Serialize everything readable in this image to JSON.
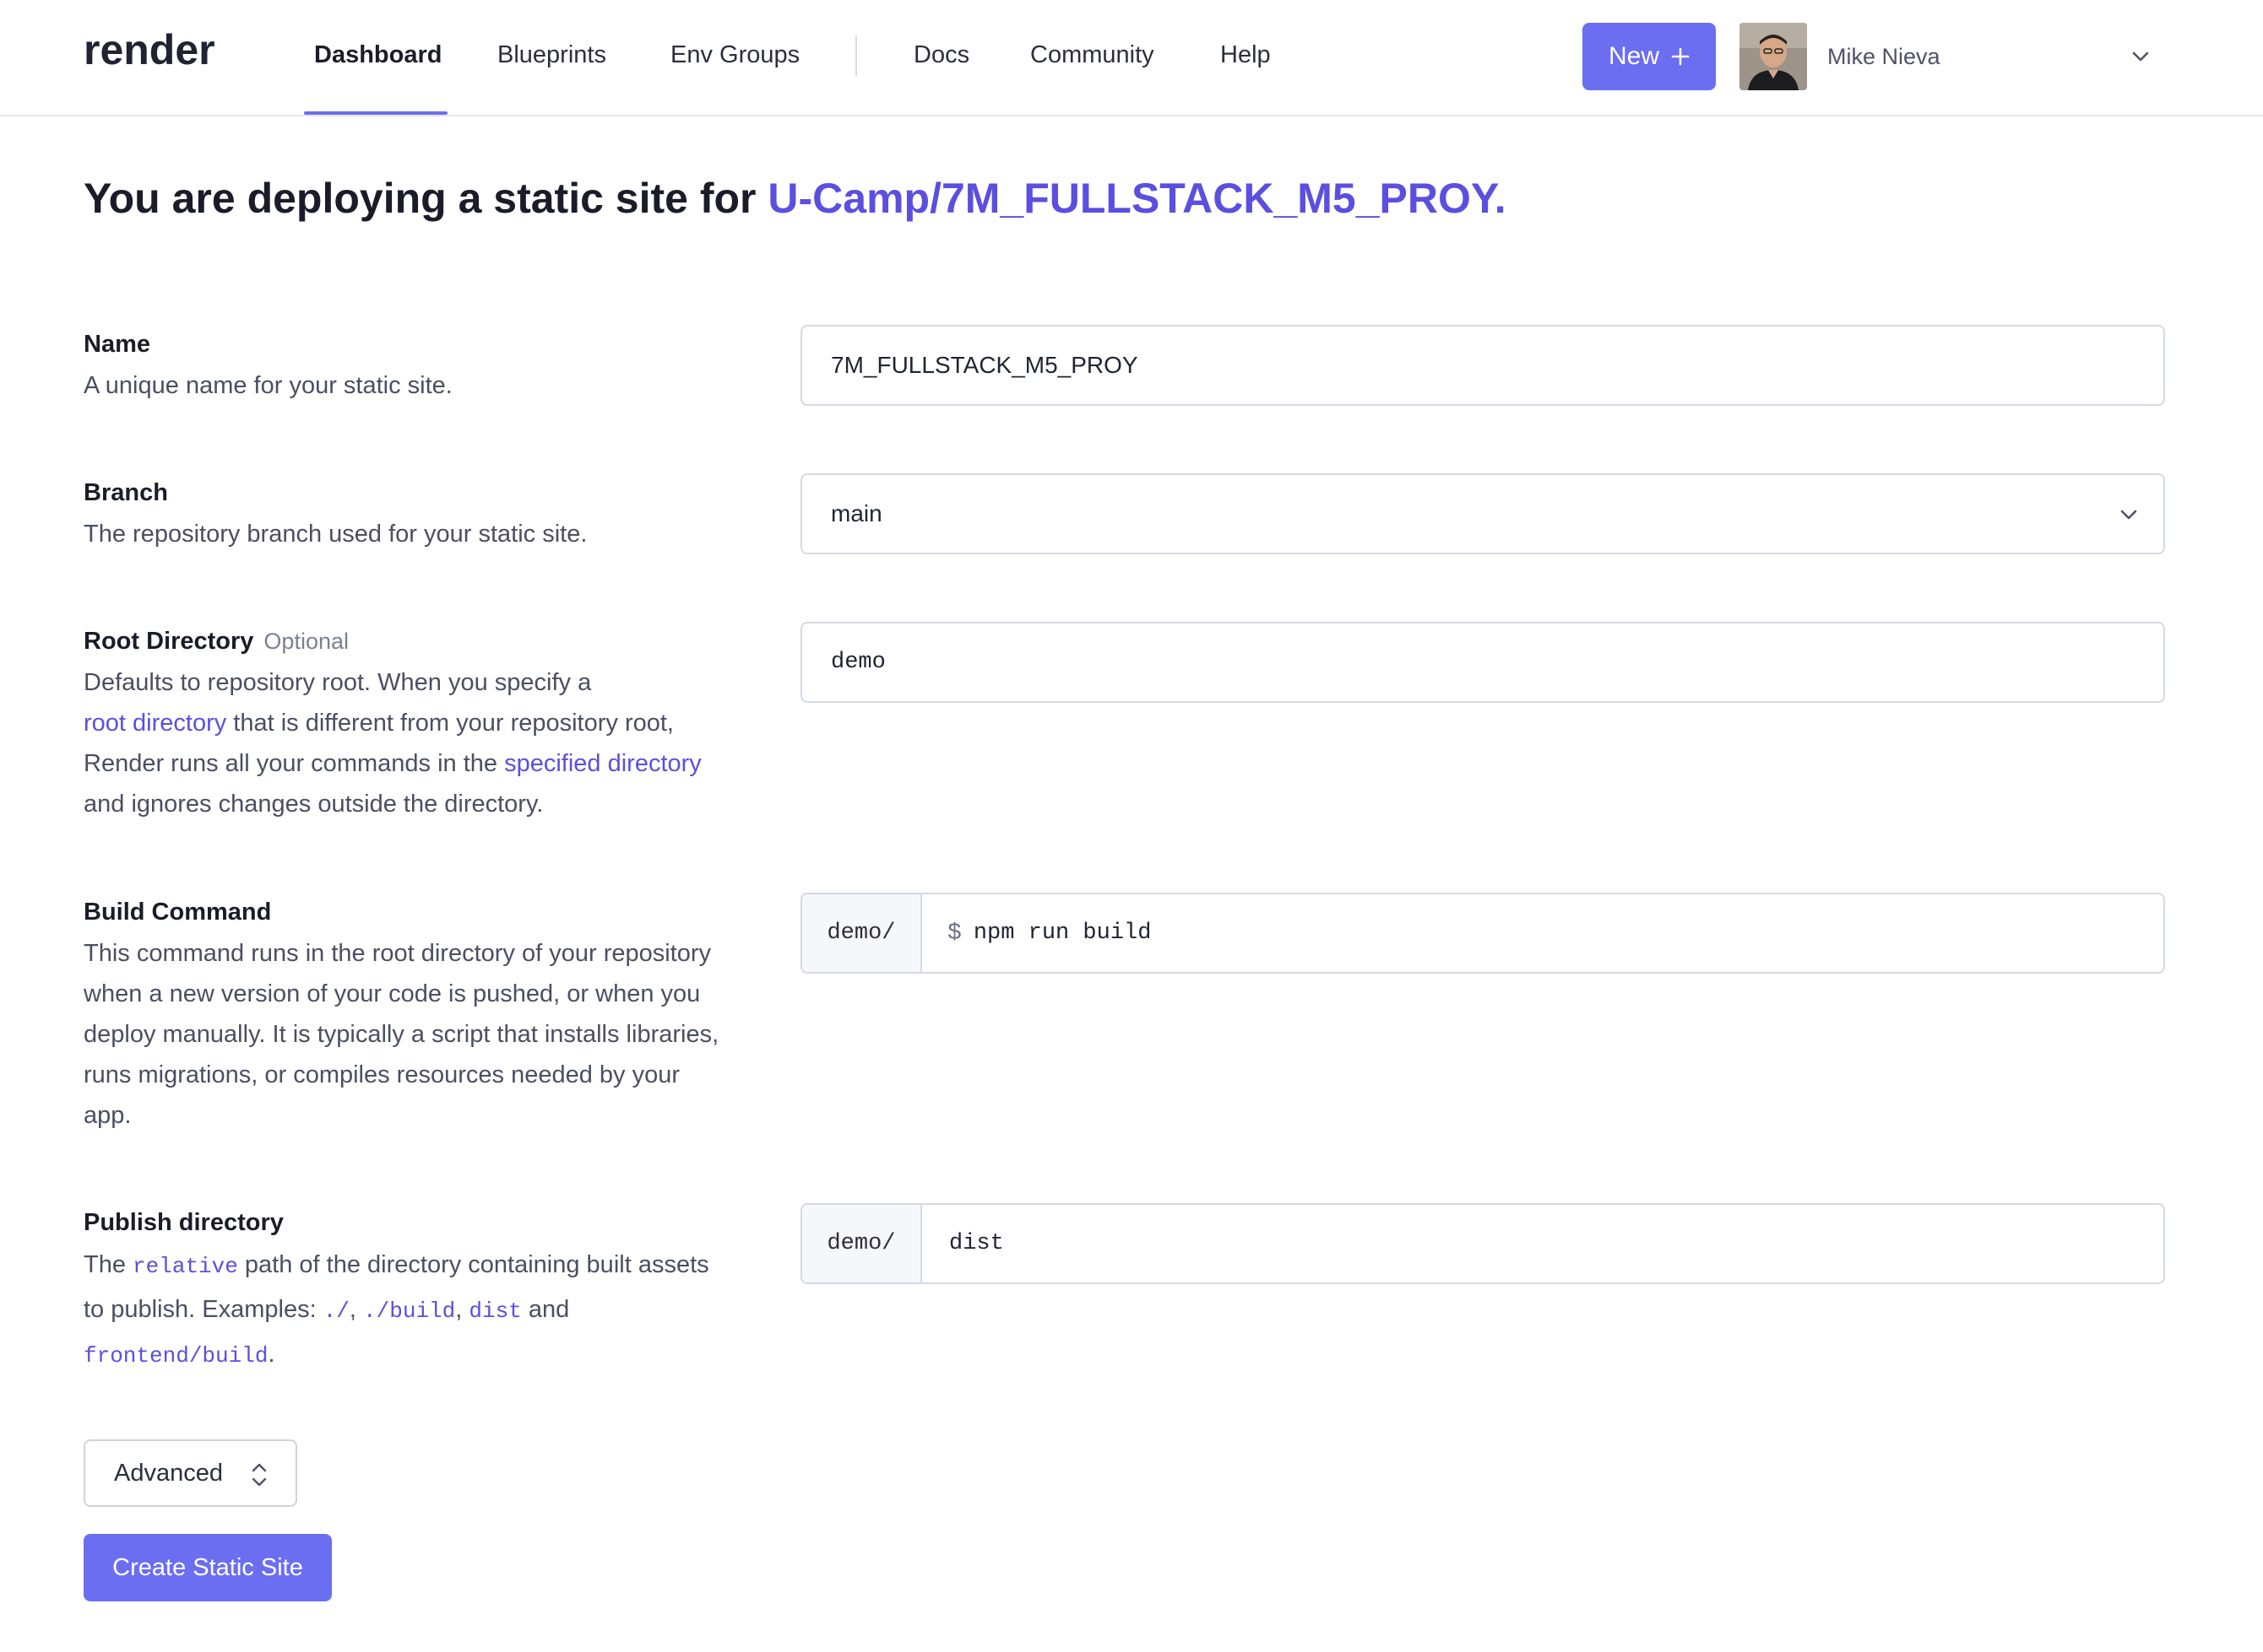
{
  "brand": {
    "logo": "render"
  },
  "nav": {
    "items": [
      {
        "label": "Dashboard",
        "active": true
      },
      {
        "label": "Blueprints"
      },
      {
        "label": "Env Groups"
      },
      {
        "label": "Docs"
      },
      {
        "label": "Community"
      },
      {
        "label": "Help"
      }
    ],
    "new_button": "New",
    "user_name": "Mike Nieva"
  },
  "page": {
    "title_prefix": "You are deploying a static site for ",
    "repo": "U-Camp/7M_FULLSTACK_M5_PROY."
  },
  "form": {
    "name": {
      "label": "Name",
      "desc": "A unique name for your static site.",
      "value": "7M_FULLSTACK_M5_PROY"
    },
    "branch": {
      "label": "Branch",
      "desc": "The repository branch used for your static site.",
      "value": "main"
    },
    "root_dir": {
      "label": "Root Directory",
      "optional": "Optional",
      "desc_1": "Defaults to repository root. When you specify a",
      "link_1": "root directory",
      "desc_2": " that is different from your repository root, Render runs all your commands in the ",
      "link_2": "specified directory",
      "desc_3": " and ignores changes outside the directory.",
      "value": "demo"
    },
    "build_command": {
      "label": "Build Command",
      "desc": "This command runs in the root directory of your repository when a new version of your code is pushed, or when you deploy manually. It is typically a script that installs libraries, runs migrations, or compiles resources needed by your app.",
      "prefix": "demo/",
      "dollar": "$",
      "value": "npm run build"
    },
    "publish_dir": {
      "label": "Publish directory",
      "desc_1": "The ",
      "code_1": "relative",
      "desc_2": " path of the directory containing built assets to publish. Examples: ",
      "code_2": "./",
      "sep_1": ", ",
      "code_3": "./build",
      "sep_2": ", ",
      "code_4": "dist",
      "sep_3": " and ",
      "code_5": "frontend/build",
      "desc_end": ".",
      "prefix": "demo/",
      "value": "dist"
    }
  },
  "buttons": {
    "advanced": "Advanced",
    "create": "Create Static Site"
  },
  "colors": {
    "accent": "#6b6ef1",
    "link": "#5b4fe0"
  }
}
